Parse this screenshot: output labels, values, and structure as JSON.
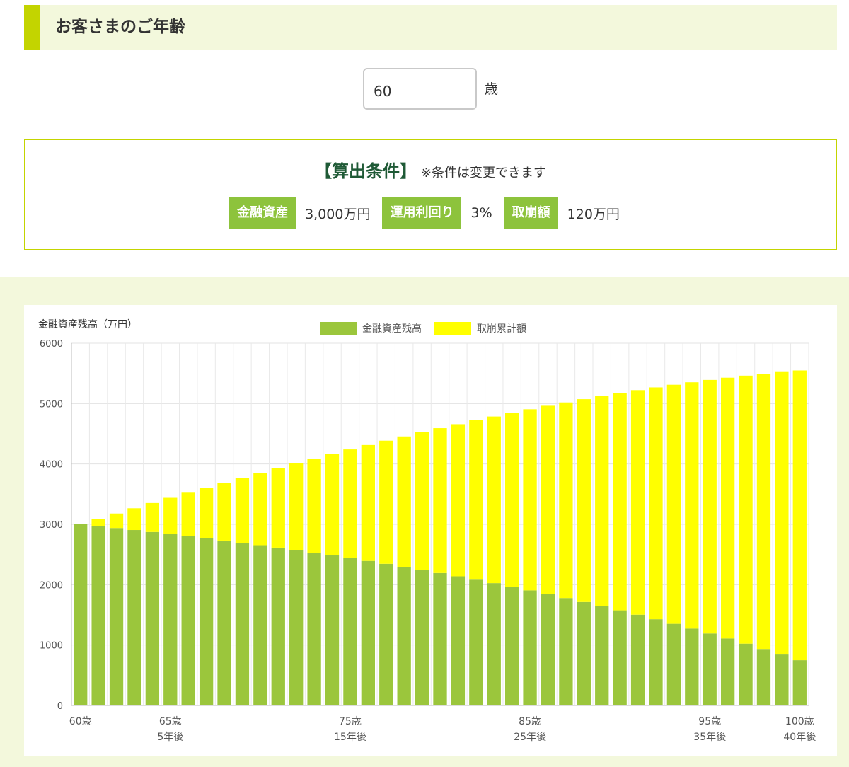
{
  "age_section": {
    "title": "お客さまのご年齢",
    "input_value": "60",
    "unit": "歳"
  },
  "conditions": {
    "title": "【算出条件】",
    "note": "※条件は変更できます",
    "items": [
      {
        "label": "金融資産",
        "value": "3,000万円"
      },
      {
        "label": "運用利回り",
        "value": "3%"
      },
      {
        "label": "取崩額",
        "value": "120万円"
      }
    ]
  },
  "colors": {
    "accent": "#c3d400",
    "badge": "#8dc33c",
    "series_balance": "#9bc63c",
    "series_withdrawn": "#ffff00",
    "title_text": "#1f5a36"
  },
  "chart_data": {
    "type": "bar",
    "stacked": true,
    "ylabel": "金融資産残高（万円）",
    "ylim": [
      0,
      6000
    ],
    "yticks": [
      0,
      1000,
      2000,
      3000,
      4000,
      5000,
      6000
    ],
    "legend_position": "top-center",
    "grid": true,
    "x": [
      0,
      1,
      2,
      3,
      4,
      5,
      6,
      7,
      8,
      9,
      10,
      11,
      12,
      13,
      14,
      15,
      16,
      17,
      18,
      19,
      20,
      21,
      22,
      23,
      24,
      25,
      26,
      27,
      28,
      29,
      30,
      31,
      32,
      33,
      34,
      35,
      36,
      37,
      38,
      39,
      40
    ],
    "x_tick_labels": [
      {
        "x": 0,
        "lines": [
          "60歳"
        ]
      },
      {
        "x": 5,
        "lines": [
          "65歳",
          "5年後"
        ]
      },
      {
        "x": 15,
        "lines": [
          "75歳",
          "15年後"
        ]
      },
      {
        "x": 25,
        "lines": [
          "85歳",
          "25年後"
        ]
      },
      {
        "x": 35,
        "lines": [
          "95歳",
          "35年後"
        ]
      },
      {
        "x": 40,
        "lines": [
          "100歳",
          "40年後"
        ]
      }
    ],
    "series": [
      {
        "name": "金融資産残高",
        "values": [
          3000,
          2970,
          2939,
          2906,
          2873,
          2839,
          2804,
          2768,
          2731,
          2693,
          2654,
          2614,
          2572,
          2530,
          2486,
          2441,
          2394,
          2346,
          2296,
          2245,
          2193,
          2139,
          2083,
          2026,
          1967,
          1906,
          1844,
          1779,
          1713,
          1645,
          1575,
          1503,
          1428,
          1352,
          1273,
          1192,
          1109,
          1023,
          935,
          843,
          749
        ]
      },
      {
        "name": "取崩累計額",
        "values": [
          0,
          120,
          240,
          360,
          480,
          600,
          720,
          840,
          960,
          1080,
          1200,
          1320,
          1440,
          1560,
          1680,
          1800,
          1920,
          2040,
          2160,
          2280,
          2400,
          2520,
          2640,
          2760,
          2880,
          3000,
          3120,
          3240,
          3360,
          3480,
          3600,
          3720,
          3840,
          3960,
          4080,
          4200,
          4320,
          4440,
          4560,
          4680,
          4800
        ]
      }
    ]
  }
}
